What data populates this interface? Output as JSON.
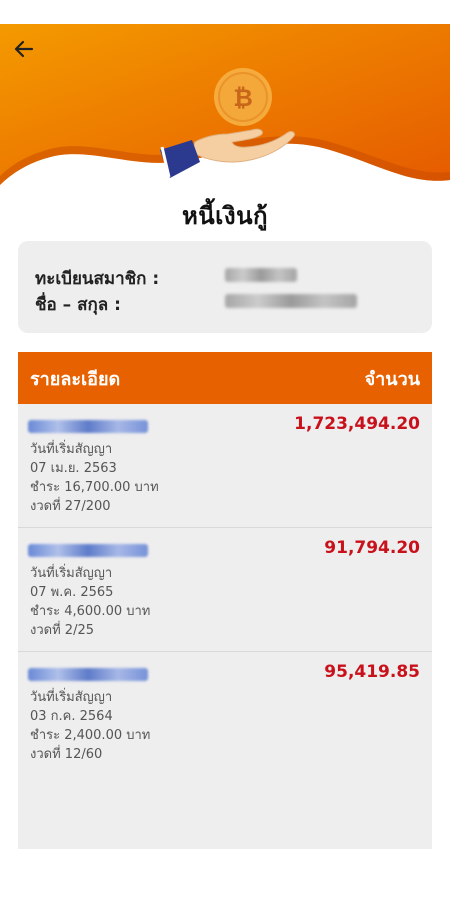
{
  "header": {
    "title": "หนี้เงินกู้",
    "colors": {
      "orange_top": "#f28a00",
      "orange_deep": "#e35c00",
      "accent_red": "#c8111b"
    }
  },
  "member": {
    "id_label": "ทะเบียนสมาชิก :",
    "name_label": "ชื่อ – สกุล :"
  },
  "table": {
    "header_detail": "รายละเอียด",
    "header_amount": "จำนวน",
    "items": [
      {
        "amount": "1,723,494.20",
        "start_label": "วันที่เริ่มสัญญา",
        "start_date": "07 เม.ย. 2563",
        "payment": "ชำระ  16,700.00 บาท",
        "installment": "งวดที่  27/200"
      },
      {
        "amount": "91,794.20",
        "start_label": "วันที่เริ่มสัญญา",
        "start_date": "07 พ.ค. 2565",
        "payment": "ชำระ  4,600.00 บาท",
        "installment": "งวดที่  2/25"
      },
      {
        "amount": "95,419.85",
        "start_label": "วันที่เริ่มสัญญา",
        "start_date": "03 ก.ค. 2564",
        "payment": "ชำระ  2,400.00 บาท",
        "installment": "งวดที่  12/60"
      }
    ]
  },
  "icons": [
    "back-arrow-icon",
    "bitcoin-coin-icon",
    "hand-icon"
  ]
}
